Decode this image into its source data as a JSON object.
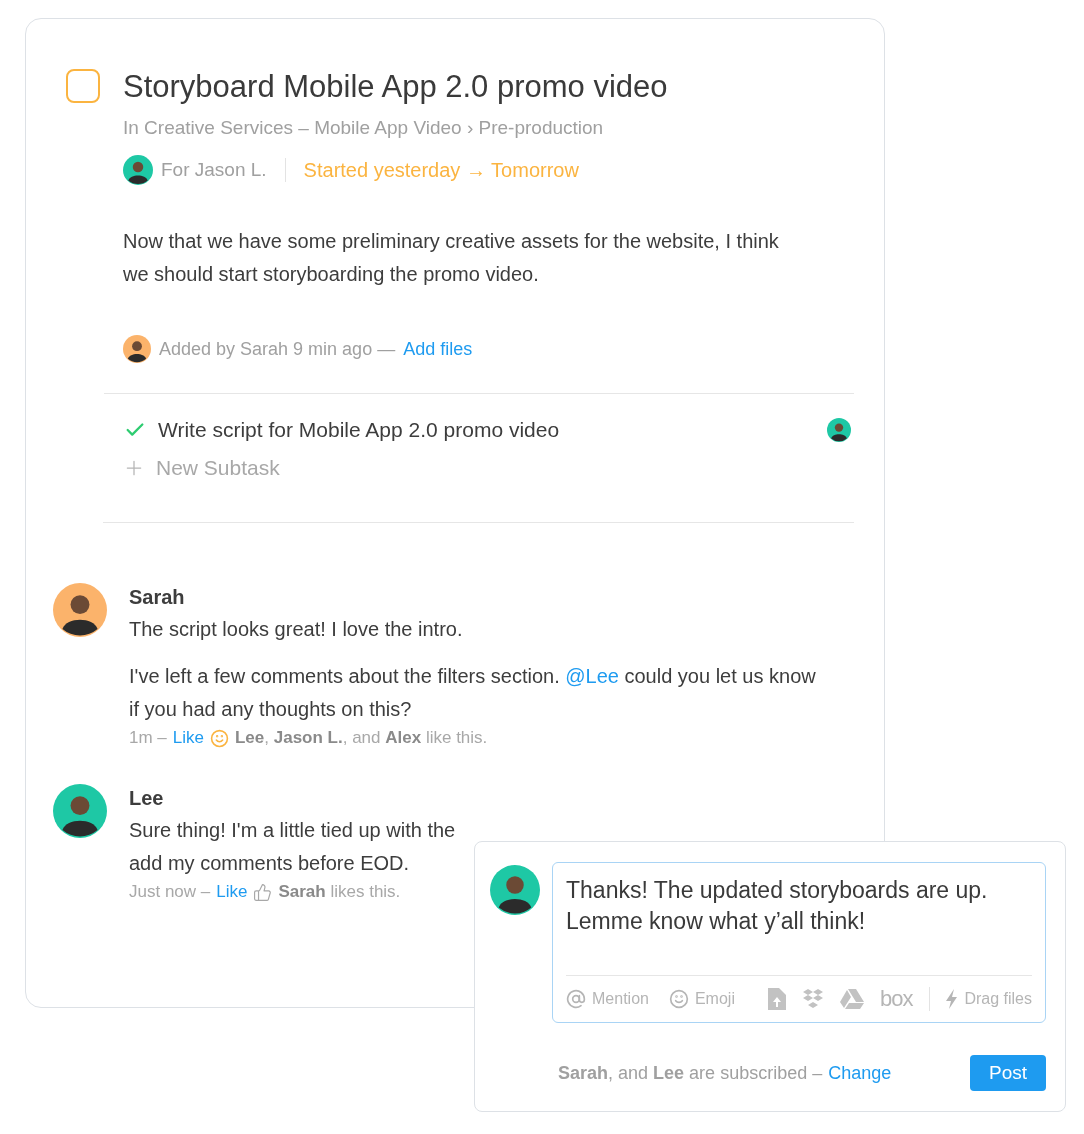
{
  "task": {
    "checked": false,
    "title": "Storyboard Mobile App 2.0 promo video",
    "breadcrumb": "In Creative Services – Mobile App Video › Pre-production",
    "assignee": "For Jason L.",
    "dates": "Started yesterday → Tomorrow",
    "description": "Now that we have some preliminary creative assets for the website, I think we should start storyboarding the promo video.",
    "added": "Added by Sarah 9 min ago —",
    "add_files": "Add files"
  },
  "subtasks": [
    {
      "label": "Write script for Mobile App 2.0 promo video",
      "done": true
    }
  ],
  "new_subtask": "New Subtask",
  "comments": [
    {
      "author": "Sarah",
      "color": "#fbb36b",
      "paragraphs": [
        [
          {
            "kind": "text",
            "text": "The script looks great! I love the intro."
          }
        ],
        [
          {
            "kind": "text",
            "text": "I've left a few comments about the filters section. "
          },
          {
            "kind": "mention",
            "text": "@Lee"
          },
          {
            "kind": "text",
            "text": " could you let us know if you had any thoughts on this?"
          }
        ]
      ],
      "time": "1m –",
      "like": "Like",
      "kind": "smile",
      "likes": "**Lee**, **Jason L.**, and **Alex** like this."
    },
    {
      "author": "Lee",
      "color": "#1ec8a5",
      "paragraphs": [
        [
          {
            "kind": "text",
            "text": "Sure thing! I'm a little tied up with the"
          },
          {
            "kind": "break"
          },
          {
            "kind": "text",
            "text": "add my comments before EOD."
          }
        ]
      ],
      "time": "Just now –",
      "like": "Like",
      "kind": "thumb",
      "likes": "**Sarah** likes this."
    }
  ],
  "composer": {
    "value": "Thanks! The updated storyboards are up.\nLemme know what y’all think!",
    "tools": [
      {
        "kind": "mention",
        "label": "Mention"
      },
      {
        "kind": "emoji",
        "label": "Emoji"
      }
    ],
    "services": [
      {
        "kind": "file"
      },
      {
        "kind": "dropbox"
      },
      {
        "kind": "drive"
      },
      {
        "kind": "box",
        "label": "box"
      }
    ],
    "drag": "Drag files",
    "subscribers": "**Sarah**, and **Lee** are subscribed –",
    "change": "Change",
    "post": "Post"
  }
}
